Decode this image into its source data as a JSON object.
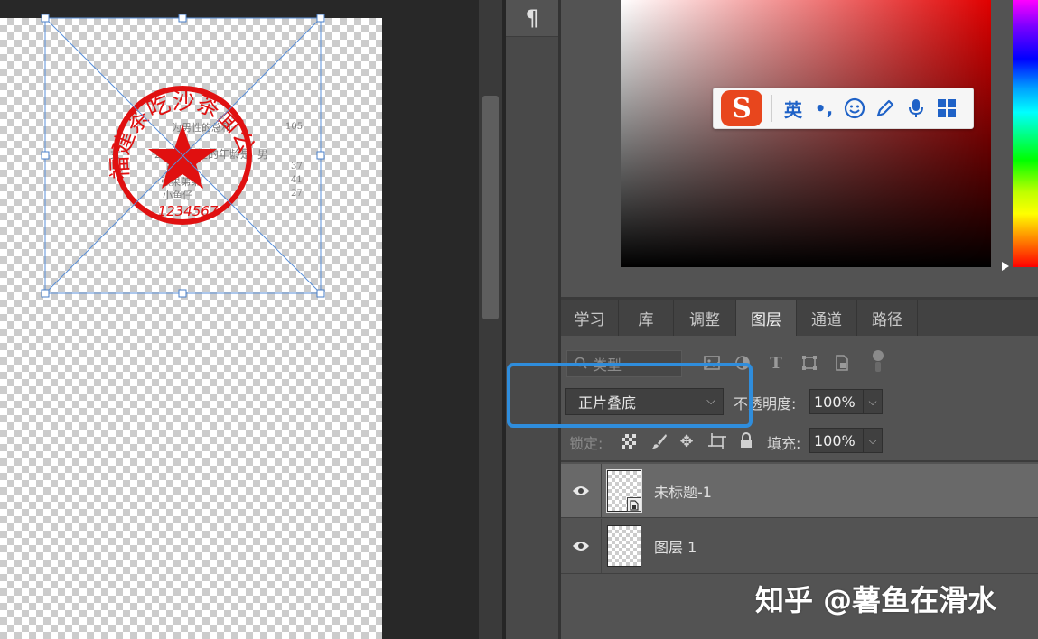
{
  "canvas": {
    "seal": {
      "ring_text": "福建茶吃沙茶面公司",
      "number_text": "1234567",
      "color": "#e01010"
    },
    "background_text": {
      "line1": "为男性的总和",
      "line1_num": "105",
      "line2_prefix": "女",
      "line2": "公司的女性的年龄是",
      "line2_suffix": "男",
      "row_names": [
        "张果",
        "张果弟弟",
        "小鱼仔"
      ],
      "row_nums": [
        "37",
        "41",
        "27"
      ]
    }
  },
  "sidebar": {
    "paragraph_icon_glyph": "¶"
  },
  "ime": {
    "lang": "英",
    "punct": "•,",
    "logo": "S"
  },
  "panel_tabs": [
    {
      "label": "学习"
    },
    {
      "label": "库"
    },
    {
      "label": "调整"
    },
    {
      "label": "图层",
      "active": true
    },
    {
      "label": "通道"
    },
    {
      "label": "路径"
    }
  ],
  "layers": {
    "filter_placeholder": "类型",
    "blend_mode": "正片叠底",
    "opacity_label": "不透明度:",
    "opacity_value": "100%",
    "lock_label": "锁定:",
    "fill_label": "填充:",
    "fill_value": "100%",
    "items": [
      {
        "name": "未标题-1",
        "selected": true,
        "smart_object": true
      },
      {
        "name": "图层 1",
        "selected": false
      }
    ]
  },
  "watermark": "知乎 @薯鱼在滑水",
  "colors": {
    "accent_highlight": "#2f8ddc",
    "panel_bg": "#535353",
    "seal_red": "#e01010"
  }
}
